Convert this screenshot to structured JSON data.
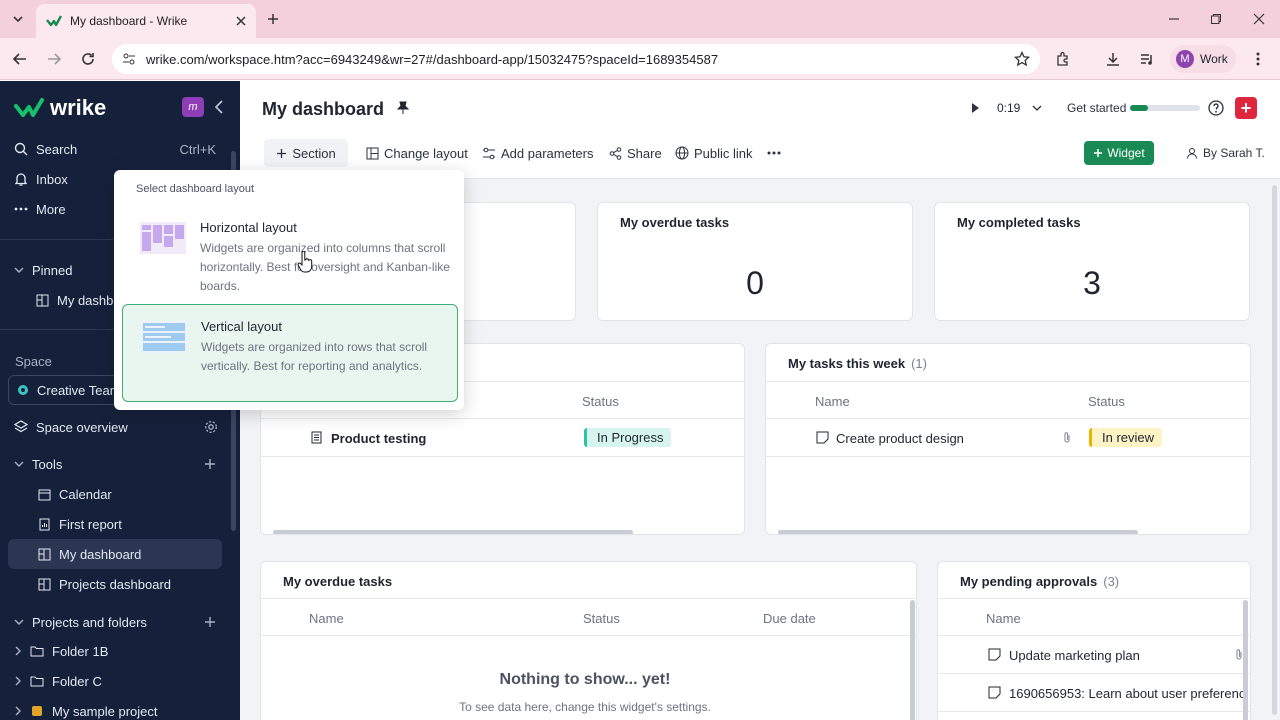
{
  "browser": {
    "tab_title": "My dashboard - Wrike",
    "url": "wrike.com/workspace.htm?acc=6943249&wr=27#/dashboard-app/15032475?spaceId=1689354587",
    "profile_label": "Work",
    "profile_initial": "M"
  },
  "sidebar": {
    "logo": "wrike",
    "search_label": "Search",
    "search_shortcut": "Ctrl+K",
    "inbox_label": "Inbox",
    "more_label": "More",
    "pinned_label": "Pinned",
    "pinned_item": "My dashb",
    "space_label": "Space",
    "space_name": "Creative Team",
    "space_overview": "Space overview",
    "tools_label": "Tools",
    "tools_items": [
      "Calendar",
      "First report",
      "My dashboard",
      "Projects dashboard"
    ],
    "projects_label": "Projects and folders",
    "folders": [
      "Folder 1B",
      "Folder C",
      "My sample project"
    ]
  },
  "header": {
    "title": "My dashboard",
    "timer": "0:19",
    "get_started": "Get started",
    "get_started_progress": 0.25,
    "toolbar": {
      "section": "Section",
      "change_layout": "Change layout",
      "add_parameters": "Add parameters",
      "share": "Share",
      "public_link": "Public link",
      "widget": "Widget",
      "by_user": "By Sarah T."
    }
  },
  "widgets": {
    "overdue_count_title": "My overdue tasks",
    "overdue_count_value": "0",
    "completed_title": "My completed tasks",
    "completed_value": "3",
    "left_table": {
      "status_header": "Status",
      "row_name": "Product testing",
      "row_status": "In Progress"
    },
    "week": {
      "title": "My tasks this week",
      "count": "(1)",
      "name_header": "Name",
      "status_header": "Status",
      "row_name": "Create product design",
      "row_status": "In review"
    },
    "overdue_list": {
      "title": "My overdue tasks",
      "name_header": "Name",
      "status_header": "Status",
      "due_header": "Due date",
      "empty_title": "Nothing to show... yet!",
      "empty_hint": "To see data here, change this widget's settings."
    },
    "approvals": {
      "title": "My pending approvals",
      "count": "(3)",
      "name_header": "Name",
      "rows": [
        "Update marketing plan",
        "1690656953: Learn about user preferenc"
      ]
    }
  },
  "layout_popup": {
    "heading": "Select dashboard layout",
    "horizontal_title": "Horizontal layout",
    "horizontal_desc": "Widgets are organized into columns that scroll horizontally. Best for oversight and Kanban-like boards.",
    "vertical_title": "Vertical layout",
    "vertical_desc": "Widgets are organized into rows that scroll vertically. Best for reporting and analytics."
  },
  "colors": {
    "sidebar_bg": "#15213b",
    "accent_green": "#1a8a54",
    "in_progress_bg": "#d6f5ef",
    "in_review_bg": "#fdf3c4"
  }
}
